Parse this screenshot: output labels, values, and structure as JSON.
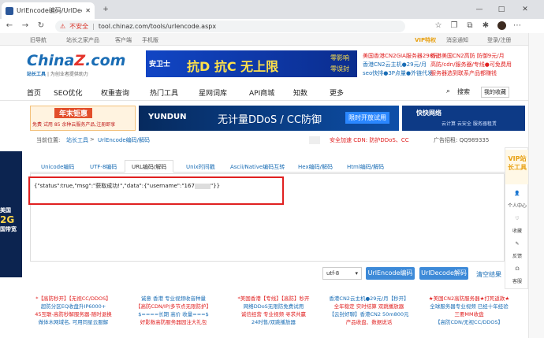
{
  "browser": {
    "tab_title": "UrlEncode编码/UrlDecode解码",
    "tab_close": "✕",
    "new_tab": "+",
    "url_warning": "不安全",
    "url": "tool.chinaz.com/tools/urlencode.aspx",
    "minimize": "—",
    "maximize": "□",
    "close": "✕"
  },
  "topbar": {
    "old_nav": "旧导航",
    "home": "站长之家产品",
    "client": "客户端",
    "mobile": "手机版",
    "vip": "VIP特权",
    "notify": "消息通知",
    "login": "登录/注册"
  },
  "logo": {
    "main_a": "China",
    "main_b": "Z",
    "main_c": ".com",
    "sub": "站长工具",
    "slogan": "| 为创业者提供助力"
  },
  "banner1": {
    "brand": "安卫士",
    "headline": "抗D 抗C 无上限",
    "tag1": "零影响",
    "tag2": "零误封"
  },
  "right_ads": [
    "美国香港CN2GIA服务器298元",
    "香港美国CN2高防 防御9元/月",
    "香港CN2云主机●29元/月",
    "高防/cdn/服务器/专线●可免费用",
    "seo快排●3P点量●外链代发",
    "服务器选到联系产品都赚钱"
  ],
  "nav": [
    "首页",
    "SEO优化",
    "权重查询",
    "热门工具",
    "星网词库",
    "API商城",
    "知数",
    "更多"
  ],
  "nav_right": {
    "search": "搜索",
    "favorites": "我的收藏"
  },
  "banner2": {
    "left_top": "年末钜惠",
    "left_bottom": "免费 试用 85 余种云服务产品,注册即享",
    "yundun": "YUNDUN",
    "ddos": "无计量DDoS / CC防御",
    "limited": "限时开放试用",
    "kuai": "快快网络",
    "kuai_tags": "云计算  云安全  服务器租赁"
  },
  "crumb": {
    "label": "当前位置:",
    "home": "站长工具",
    "sep": ">",
    "page": "UrlEncode编码/解码",
    "ad": "安全加速 CDN: 防护DDoS、CC",
    "ad_contact": "广告招租: QQ989335"
  },
  "tabs": [
    "Unicode编码",
    "UTF-8编码",
    "URL编码/解码",
    "Unix时间戳",
    "Ascii/Native编码互转",
    "Hex编码/解码",
    "Html编码/解码"
  ],
  "editor": {
    "output_prefix": "{\"status\":true,\"msg\":\"获取成功!\",\"data\":{\"username\":\"167",
    "output_suffix": "\"}}"
  },
  "controls": {
    "charset": "utf-8",
    "encode": "UrlEncode编码",
    "decode": "UrlDecode解码",
    "clear": "清空结果"
  },
  "side": {
    "vip": "VIP站长工具",
    "personal": "个人中心",
    "fav": "收藏",
    "feedback": "反馈",
    "help": "客服"
  },
  "left_ad": {
    "line1": "美国",
    "line2": "2G",
    "line3": "国带宽"
  },
  "bottom_ads": [
    [
      "*【高防秒开】【无视CC/DDOS】",
      "超防分区EQ收盘升IP6000+",
      "45互联-高防秒解服务器-随时退换",
      "做体木网域名, 可用同星云服解"
    ],
    [
      "诚意 香港 专业视频收音种量",
      "【高防CDN/IP/多节点无限防护】",
      "$====长期 高价 收量===$",
      "好影数高防服务器园注大礼包"
    ],
    [
      "*美国香港【专线】【高防】秒开",
      "网络DDoS无限防免费试用",
      "诚信经营 专业视频 寻求共赢",
      "24时售/双跳播放器"
    ],
    [
      "香港CN2云主机●29元/月【秒开】",
      "全年稳定 实时结算 双跳播放器",
      "【云封好聊】香港CN2 50m800元",
      "产品收盘、数据说话"
    ],
    [
      "★美国CN2高防服务器★打死返款★",
      "全球服务器专业视频 已经十年经验",
      "三要MM收盘",
      "【高防CDN/无视CC/DDOS】"
    ]
  ]
}
